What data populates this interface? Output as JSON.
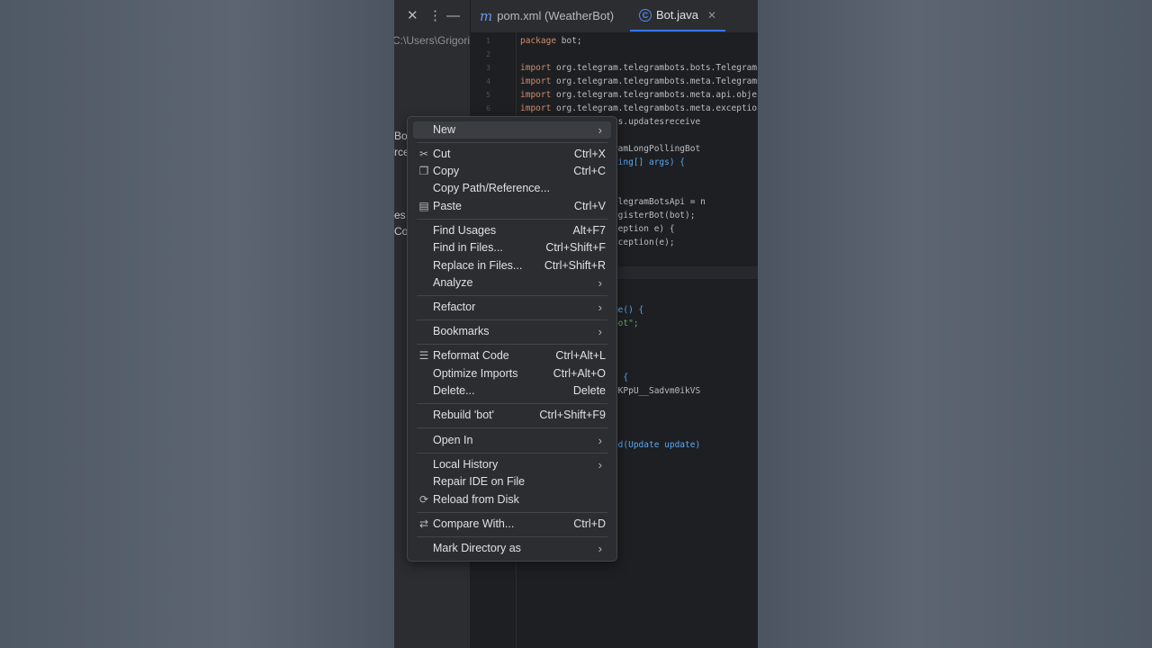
{
  "tabs": [
    {
      "label": "pom.xml (WeatherBot)",
      "icon": "maven-m-icon"
    },
    {
      "label": "Bot.java",
      "icon": "class-c-icon",
      "active": true
    }
  ],
  "project": {
    "path": "C:\\Users\\Grigori",
    "fragments": [
      "Bo",
      "rce",
      "es",
      "Co"
    ]
  },
  "editor": {
    "line_numbers": [
      "1",
      "2",
      "3",
      "4",
      "5",
      "6"
    ],
    "lines": [
      "package bot;",
      "",
      "import org.telegram.telegrambots.bots.TelegramL",
      "import org.telegram.telegrambots.meta.TelegramB",
      "import org.telegram.telegrambots.meta.api.objec",
      "import org.telegram.telegrambots.meta.exception",
      "       .telegrambots.updatesreceive",
      "",
      "       tends TelegramLongPollingBot",
      "       oid main(String[] args) {",
      "",
      "       = new Bot();",
      "       amBotsApi telegramBotsApi = n",
      "       amBotsApi.registerBot(bot);",
      "       legramApiException e) {",
      "       ew RuntimeException(e);",
      "",
      "",
      "",
      "",
      "       etBotUsername() {",
      "       adeyweatherBot\";",
      "",
      "",
      "",
      "       etBotToken() {",
      "       9255701:AAHnKPpU__Sadvm0ikVS",
      "",
      "",
      "",
      "       pdateReceived(Update update)"
    ]
  },
  "context_menu": {
    "items": [
      {
        "label": "New",
        "submenu": true,
        "highlighted": true
      },
      {
        "label": "Cut",
        "shortcut": "Ctrl+X",
        "icon": "scissors-icon"
      },
      {
        "label": "Copy",
        "shortcut": "Ctrl+C",
        "icon": "copy-icon"
      },
      {
        "label": "Copy Path/Reference..."
      },
      {
        "label": "Paste",
        "shortcut": "Ctrl+V",
        "icon": "paste-icon"
      },
      {
        "label": "Find Usages",
        "shortcut": "Alt+F7"
      },
      {
        "label": "Find in Files...",
        "shortcut": "Ctrl+Shift+F"
      },
      {
        "label": "Replace in Files...",
        "shortcut": "Ctrl+Shift+R"
      },
      {
        "label": "Analyze",
        "submenu": true
      },
      {
        "label": "Refactor",
        "submenu": true
      },
      {
        "label": "Bookmarks",
        "submenu": true
      },
      {
        "label": "Reformat Code",
        "shortcut": "Ctrl+Alt+L",
        "icon": "reformat-icon"
      },
      {
        "label": "Optimize Imports",
        "shortcut": "Ctrl+Alt+O"
      },
      {
        "label": "Delete...",
        "shortcut": "Delete"
      },
      {
        "label": "Rebuild 'bot'",
        "shortcut": "Ctrl+Shift+F9"
      },
      {
        "label": "Open In",
        "submenu": true
      },
      {
        "label": "Local History",
        "submenu": true
      },
      {
        "label": "Repair IDE on File"
      },
      {
        "label": "Reload from Disk",
        "icon": "reload-icon"
      },
      {
        "label": "Compare With...",
        "shortcut": "Ctrl+D",
        "icon": "compare-icon"
      },
      {
        "label": "Mark Directory as",
        "submenu": true
      }
    ]
  },
  "colors": {
    "accent": "#3574f0",
    "menu_bg": "#2b2d30",
    "editor_bg": "#1e1f22",
    "keyword": "#cf8e6d",
    "function": "#56a8f5",
    "string": "#6aab73"
  }
}
